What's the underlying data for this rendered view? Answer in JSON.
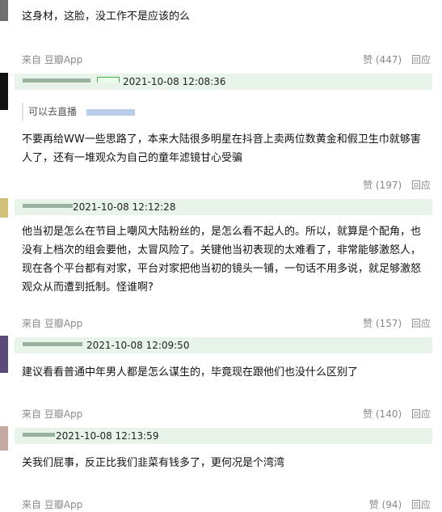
{
  "comments": [
    {
      "author": "",
      "time": "",
      "quote_prefix": "",
      "text": "这身材，这脸，没工作不是应该的么",
      "source": "来自 豆瓣App",
      "like": "赞 (447)",
      "reply": "回应"
    },
    {
      "author": "",
      "time": "2021-10-08 12:08:36",
      "quote_prefix": "可以去直播",
      "text": "不要再给WW一些思路了，本来大陆很多明星在抖音上卖两位数黄金和假卫生巾就够害人了，还有一堆观众为自己的童年滤镜甘心受骗",
      "source": "",
      "like": "赞 (197)",
      "reply": "回应"
    },
    {
      "author": "",
      "time": "2021-10-08 12:12:28",
      "quote_prefix": "",
      "text": "他当初是怎么在节目上嘲风大陆粉丝的，是怎么看不起人的。所以，就算是个配角，也没有上档次的组会要他，太冒风险了。关键他当初表现的太难看了，非常能够激怒人，现在各个平台都有对家，平台对家把他当初的镜头一铺，一句话不用多说，就足够激怒观众从而遭到抵制。怪谁啊?",
      "source": "来自 豆瓣App",
      "like": "赞 (157)",
      "reply": "回应"
    },
    {
      "author": "",
      "time": "2021-10-08 12:09:50",
      "quote_prefix": "",
      "text": "建议看看普通中年男人都是怎么谋生的，毕竟现在跟他们也没什么区别了",
      "source": "来自 豆瓣App",
      "like": "赞 (140)",
      "reply": "回应"
    },
    {
      "author": "",
      "time": "2021-10-08 12:13:59",
      "quote_prefix": "",
      "text": "关我们屁事，反正比我们韭菜有钱多了，更何况是个湾湾",
      "source": "来自 豆瓣App",
      "like": "赞 (94)",
      "reply": "回应"
    }
  ],
  "colors": {
    "header_bg": "#e8f3ea",
    "meta_text": "#8a8a8a",
    "body_text": "#111111"
  }
}
